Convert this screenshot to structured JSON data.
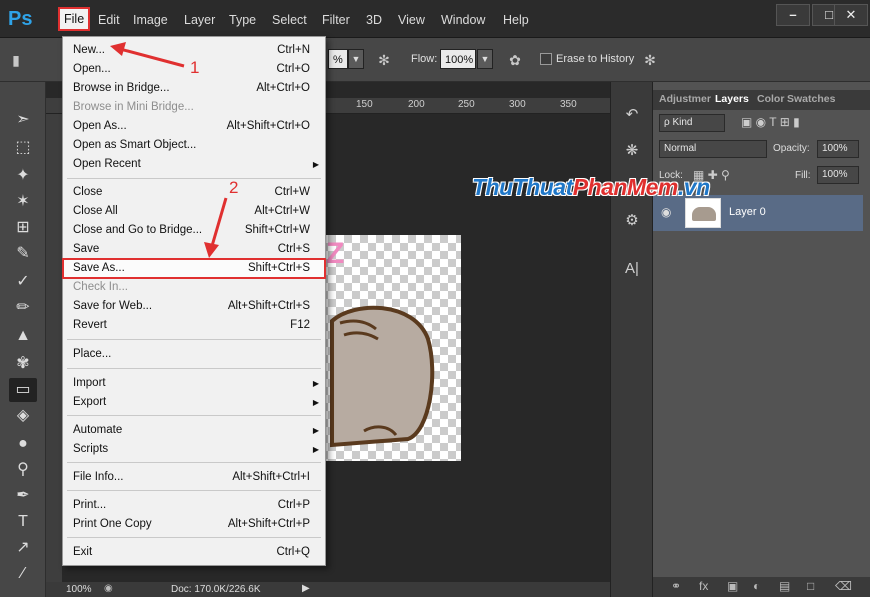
{
  "app": {
    "logo": "Ps"
  },
  "menubar": {
    "items": [
      "File",
      "Edit",
      "Image",
      "Layer",
      "Type",
      "Select",
      "Filter",
      "3D",
      "View",
      "Window",
      "Help"
    ],
    "window_buttons": [
      "–",
      "□",
      "✕"
    ]
  },
  "options_bar": {
    "opacity_value": "%",
    "flow_label": "Flow:",
    "flow_value": "100%",
    "erase_history_label": "Erase to History"
  },
  "ruler": {
    "ticks": [
      "150",
      "200",
      "250",
      "300",
      "350"
    ]
  },
  "file_menu": {
    "items": [
      {
        "label": "New...",
        "shortcut": "Ctrl+N"
      },
      {
        "label": "Open...",
        "shortcut": "Ctrl+O"
      },
      {
        "label": "Browse in Bridge...",
        "shortcut": "Alt+Ctrl+O"
      },
      {
        "label": "Browse in Mini Bridge...",
        "shortcut": "",
        "disabled": true
      },
      {
        "label": "Open As...",
        "shortcut": "Alt+Shift+Ctrl+O"
      },
      {
        "label": "Open as Smart Object...",
        "shortcut": ""
      },
      {
        "label": "Open Recent",
        "shortcut": "",
        "submenu": true
      },
      {
        "label": "Close",
        "shortcut": "Ctrl+W"
      },
      {
        "label": "Close All",
        "shortcut": "Alt+Ctrl+W"
      },
      {
        "label": "Close and Go to Bridge...",
        "shortcut": "Shift+Ctrl+W"
      },
      {
        "label": "Save",
        "shortcut": "Ctrl+S"
      },
      {
        "label": "Save As...",
        "shortcut": "Shift+Ctrl+S"
      },
      {
        "label": "Check In...",
        "shortcut": "",
        "disabled": true
      },
      {
        "label": "Save for Web...",
        "shortcut": "Alt+Shift+Ctrl+S"
      },
      {
        "label": "Revert",
        "shortcut": "F12"
      },
      {
        "label": "Place...",
        "shortcut": ""
      },
      {
        "label": "Import",
        "shortcut": "",
        "submenu": true
      },
      {
        "label": "Export",
        "shortcut": "",
        "submenu": true
      },
      {
        "label": "Automate",
        "shortcut": "",
        "submenu": true
      },
      {
        "label": "Scripts",
        "shortcut": "",
        "submenu": true
      },
      {
        "label": "File Info...",
        "shortcut": "Alt+Shift+Ctrl+I"
      },
      {
        "label": "Print...",
        "shortcut": "Ctrl+P"
      },
      {
        "label": "Print One Copy",
        "shortcut": "Alt+Shift+Ctrl+P"
      },
      {
        "label": "Exit",
        "shortcut": "Ctrl+Q"
      }
    ]
  },
  "annotations": {
    "step1": "1",
    "step2": "2"
  },
  "watermark": {
    "part1": "ThuThuat",
    "part2": "PhanMem",
    "part3": ".vn"
  },
  "layers_panel": {
    "tabs": [
      "Adjustmer",
      "Layers",
      "Color",
      "Swatches"
    ],
    "kind_label": "ρ Kind",
    "blend_mode": "Normal",
    "opacity_label": "Opacity:",
    "opacity_value": "100%",
    "lock_label": "Lock:",
    "fill_label": "Fill:",
    "fill_value": "100%",
    "layer_name": "Layer 0"
  },
  "status_bar": {
    "zoom": "100%",
    "doc_info": "Doc: 170.0K/226.6K"
  },
  "colors": {
    "accent": "#2fa3e8",
    "highlight": "#e03030",
    "layer_selected": "#596b86"
  }
}
